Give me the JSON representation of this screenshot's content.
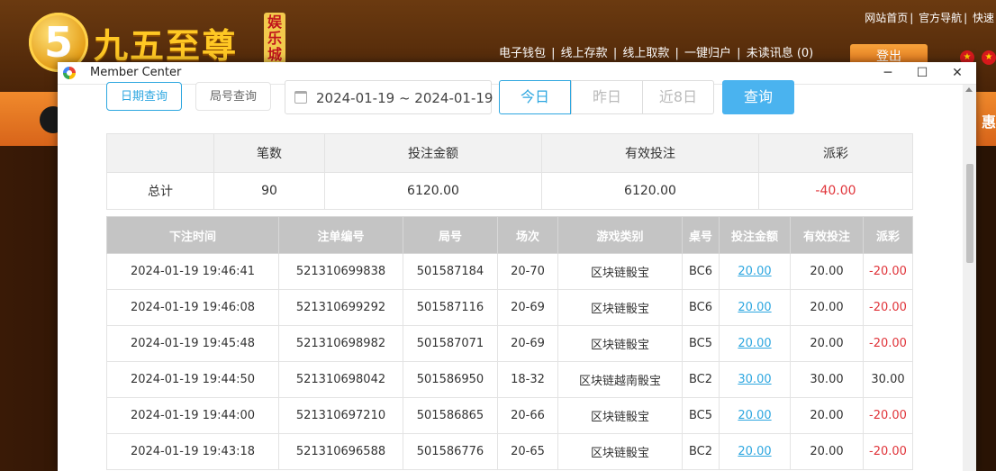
{
  "site": {
    "logo_glyph": "5",
    "logo_text": "九五至尊",
    "logo_tag": "娱乐城",
    "top_links": [
      "网站首页",
      "官方导航",
      "快速"
    ],
    "nav_links": [
      "电子钱包",
      "线上存款",
      "线上取款",
      "一键归户",
      "未读讯息 (0)"
    ],
    "logout_label": "登出",
    "promo_text": "惠"
  },
  "window": {
    "title": "Member Center",
    "minimize": "─",
    "maximize": "☐",
    "close": "✕"
  },
  "filters": {
    "tab_date": "日期查询",
    "tab_round": "局号查询",
    "date_range": "2024-01-19 ~ 2024-01-19",
    "today": "今日",
    "yesterday": "昨日",
    "last8": "近8日",
    "query": "查询"
  },
  "summary": {
    "headers": [
      "",
      "笔数",
      "投注金额",
      "有效投注",
      "派彩"
    ],
    "row": {
      "label": "总计",
      "count": "90",
      "bet": "6120.00",
      "valid": "6120.00",
      "payout": "-40.00"
    }
  },
  "detail": {
    "headers": [
      "下注时间",
      "注单编号",
      "局号",
      "场次",
      "游戏类别",
      "桌号",
      "投注金额",
      "有效投注",
      "派彩"
    ],
    "rows": [
      {
        "time": "2024-01-19 19:46:41",
        "ticket": "521310699838",
        "round": "501587184",
        "session": "20-70",
        "game": "区块链骰宝",
        "table": "BC6",
        "bet": "20.00",
        "valid": "20.00",
        "payout": "-20.00"
      },
      {
        "time": "2024-01-19 19:46:08",
        "ticket": "521310699292",
        "round": "501587116",
        "session": "20-69",
        "game": "区块链骰宝",
        "table": "BC6",
        "bet": "20.00",
        "valid": "20.00",
        "payout": "-20.00"
      },
      {
        "time": "2024-01-19 19:45:48",
        "ticket": "521310698982",
        "round": "501587071",
        "session": "20-69",
        "game": "区块链骰宝",
        "table": "BC5",
        "bet": "20.00",
        "valid": "20.00",
        "payout": "-20.00"
      },
      {
        "time": "2024-01-19 19:44:50",
        "ticket": "521310698042",
        "round": "501586950",
        "session": "18-32",
        "game": "区块链越南骰宝",
        "table": "BC2",
        "bet": "30.00",
        "valid": "30.00",
        "payout": "30.00"
      },
      {
        "time": "2024-01-19 19:44:00",
        "ticket": "521310697210",
        "round": "501586865",
        "session": "20-66",
        "game": "区块链骰宝",
        "table": "BC5",
        "bet": "20.00",
        "valid": "20.00",
        "payout": "-20.00"
      },
      {
        "time": "2024-01-19 19:43:18",
        "ticket": "521310696588",
        "round": "501586776",
        "session": "20-65",
        "game": "区块链骰宝",
        "table": "BC2",
        "bet": "20.00",
        "valid": "20.00",
        "payout": "-20.00"
      }
    ]
  },
  "colors": {
    "accent": "#2ea7e0",
    "negative": "#e0343a",
    "header_gray": "#c4c4c4"
  }
}
